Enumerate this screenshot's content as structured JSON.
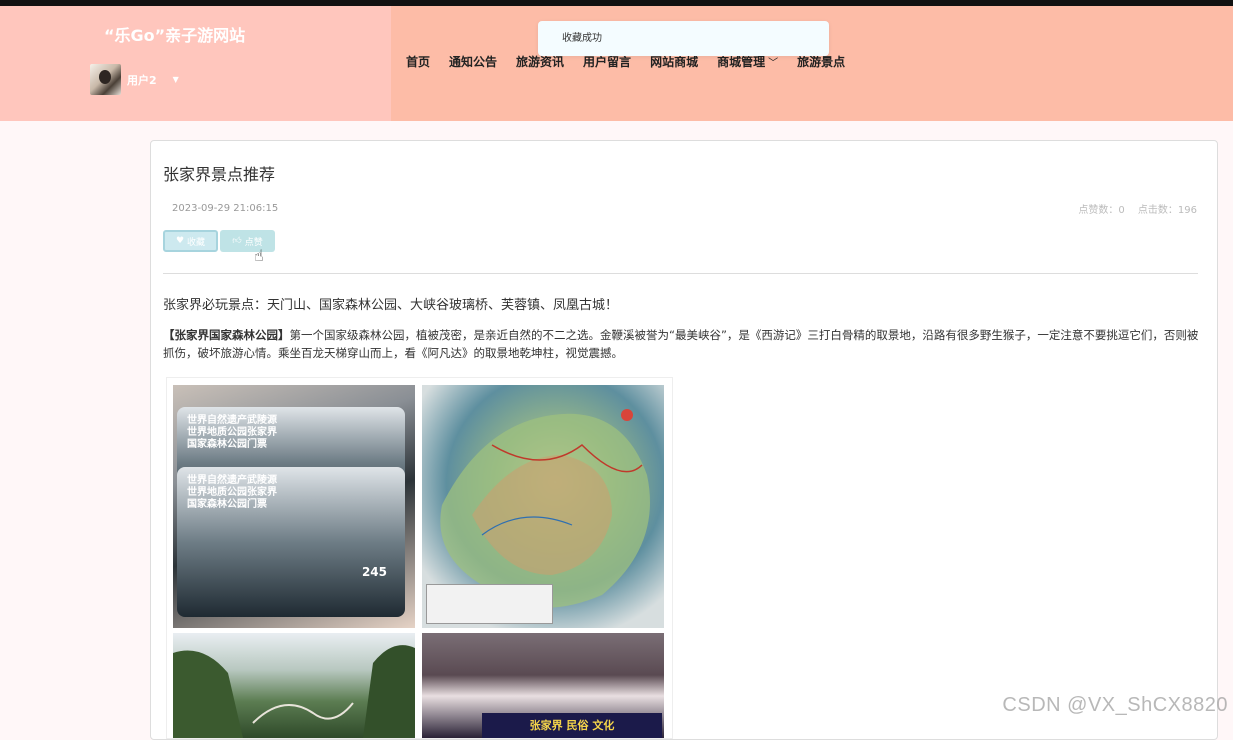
{
  "header": {
    "site_title": "“乐Go”亲子游网站",
    "user_name": "用户2",
    "nav": [
      {
        "label": "首页"
      },
      {
        "label": "通知公告"
      },
      {
        "label": "旅游资讯"
      },
      {
        "label": "用户留言"
      },
      {
        "label": "网站商城"
      },
      {
        "label": "商城管理",
        "has_dropdown": true
      },
      {
        "label": "旅游景点"
      }
    ]
  },
  "toast": {
    "message": "收藏成功"
  },
  "post": {
    "title": "张家界景点推荐",
    "date": "2023-09-29 21:06:15",
    "likes_label": "点赞数：0",
    "clicks_label": "点击数：196",
    "fav_button": "收藏",
    "like_button": "点赞",
    "intro": "张家界必玩景点：天门山、国家森林公园、大峡谷玻璃桥、芙蓉镇、凤凰古城！",
    "para_bold": "【张家界国家森林公园】",
    "para_text": "第一个国家级森林公园，植被茂密，是亲近自然的不二之选。金鞭溪被誉为“最美峡谷”，是《西游记》三打白骨精的取景地，沿路有很多野生猴子，一定注意不要挑逗它们，否则被抓伤，破坏旅游心情。乘坐百龙天梯穿山而上，看《阿凡达》的取景地乾坤柱，视觉震撼。",
    "ticket_text": "世界自然遗产武陵源\n世界地质公园张家界\n国家森林公园门票",
    "ticket_number": "245",
    "building_sign": "张家界 民俗 文化"
  },
  "watermark": "CSDN @VX_ShCX8820"
}
